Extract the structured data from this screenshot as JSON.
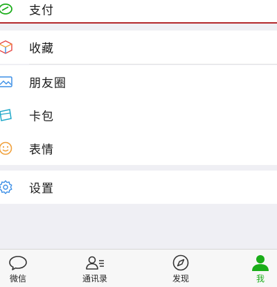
{
  "menu": {
    "pay": "支付",
    "favorites": "收藏",
    "moments": "朋友圈",
    "cards": "卡包",
    "stickers": "表情",
    "settings": "设置"
  },
  "tabbar": {
    "chats": "微信",
    "contacts": "通讯录",
    "discover": "发现",
    "me": "我"
  },
  "colors": {
    "active": "#1aad19",
    "highlight": "#b3272b"
  },
  "icons": {
    "pay": "wallet-icon",
    "favorites": "cube-icon",
    "moments": "photo-icon",
    "cards": "card-icon",
    "stickers": "smiley-icon",
    "settings": "gear-icon"
  }
}
